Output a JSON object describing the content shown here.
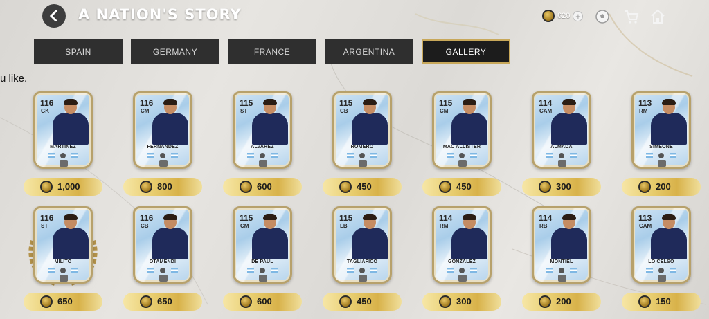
{
  "header": {
    "title": "A NATION'S STORY",
    "coins": "620",
    "icons": [
      "back-icon",
      "coin-icon",
      "plus-icon",
      "ball-icon",
      "cart-icon",
      "home-icon"
    ]
  },
  "tabs": [
    {
      "label": "SPAIN",
      "active": false
    },
    {
      "label": "GERMANY",
      "active": false
    },
    {
      "label": "FRANCE",
      "active": false
    },
    {
      "label": "ARGENTINA",
      "active": false
    },
    {
      "label": "GALLERY",
      "active": true
    }
  ],
  "subtitle": "u like.",
  "colors": {
    "accent_gold": "#c8a85a",
    "tab_bg": "#2f2f2f",
    "kit_navy": "#1f2a5a"
  },
  "cards": [
    {
      "rating": "116",
      "position": "GK",
      "name": "MARTINEZ",
      "price": "1,000"
    },
    {
      "rating": "116",
      "position": "CM",
      "name": "FERNANDEZ",
      "price": "800"
    },
    {
      "rating": "115",
      "position": "ST",
      "name": "ALVAREZ",
      "price": "600"
    },
    {
      "rating": "115",
      "position": "CB",
      "name": "ROMERO",
      "price": "450"
    },
    {
      "rating": "115",
      "position": "CM",
      "name": "MAC ALLISTER",
      "price": "450"
    },
    {
      "rating": "114",
      "position": "CAM",
      "name": "ALMADA",
      "price": "300"
    },
    {
      "rating": "113",
      "position": "RM",
      "name": "SIMEONE",
      "price": "200"
    },
    {
      "rating": "116",
      "position": "ST",
      "name": "MILITO",
      "price": "650"
    },
    {
      "rating": "116",
      "position": "CB",
      "name": "OTAMENDI",
      "price": "650"
    },
    {
      "rating": "115",
      "position": "CM",
      "name": "DE PAUL",
      "price": "600"
    },
    {
      "rating": "115",
      "position": "LB",
      "name": "TAGLIAFICO",
      "price": "450"
    },
    {
      "rating": "114",
      "position": "RM",
      "name": "GONZALEZ",
      "price": "300"
    },
    {
      "rating": "114",
      "position": "RB",
      "name": "MONTIEL",
      "price": "200"
    },
    {
      "rating": "113",
      "position": "CAM",
      "name": "LO CELSO",
      "price": "150"
    }
  ]
}
